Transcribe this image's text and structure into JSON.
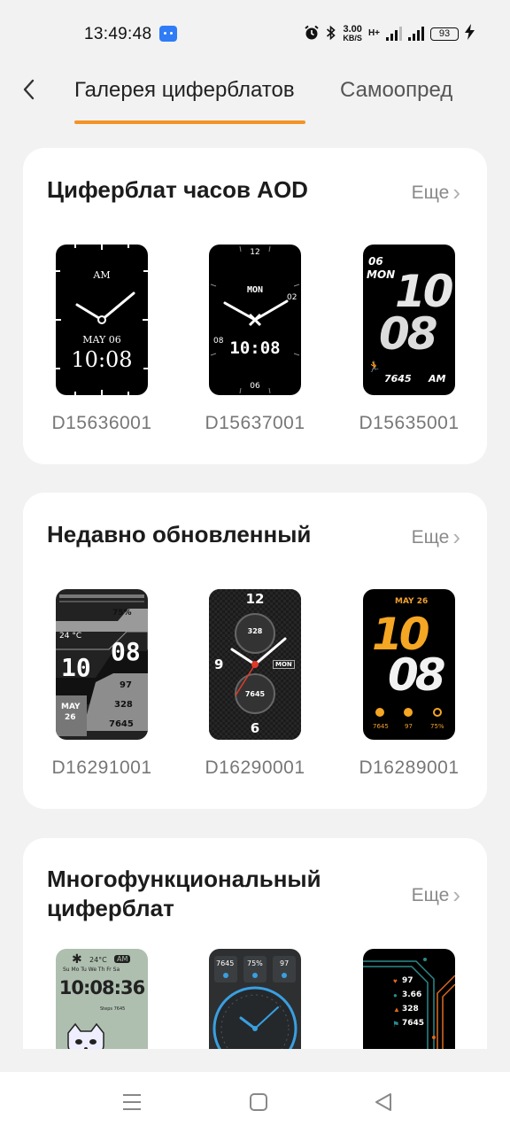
{
  "status_bar": {
    "time": "13:49:48",
    "net_speed_value": "3.00",
    "net_speed_unit": "KB/S",
    "network_type": "H+",
    "battery": "93"
  },
  "header": {
    "tabs": [
      {
        "label": "Галерея циферблатов",
        "active": true
      },
      {
        "label": "Самоопред"
      }
    ]
  },
  "sections": [
    {
      "title": "Циферблат часов AOD",
      "more_label": "Еще",
      "faces": [
        {
          "id": "D15636001",
          "style": "analog-serif",
          "top_text": "AM",
          "date": "MAY 06",
          "time": "10:08"
        },
        {
          "id": "D15637001",
          "style": "analog-digital",
          "num_12": "12",
          "day": "MON",
          "num_02": "02",
          "num_08": "08",
          "time": "10:08",
          "num_06": "06"
        },
        {
          "id": "D15635001",
          "style": "big-digital",
          "date": "06",
          "day": "MON",
          "hour": "10",
          "minute": "08",
          "steps": "7645",
          "ampm": "AM"
        }
      ]
    },
    {
      "title": "Недавно обновленный",
      "more_label": "Еще",
      "faces": [
        {
          "id": "D16291001",
          "style": "grey-tech",
          "battery": "75%",
          "temp": "24 °C",
          "hour": "10",
          "minute": "08",
          "heart": "97",
          "month": "MAY",
          "day": "26",
          "calories": "328",
          "steps": "7645"
        },
        {
          "id": "D16290001",
          "style": "carbon-analog",
          "num_12": "12",
          "num_9": "9",
          "num_6": "6",
          "sub_top": "328",
          "sub_bottom": "7645",
          "day": "MON"
        },
        {
          "id": "D16289001",
          "style": "orange-digital",
          "date": "MAY 26",
          "hour": "10",
          "minute": "08",
          "steps": "7645",
          "heart": "97",
          "battery": "75%"
        }
      ]
    },
    {
      "title": "Многофункциональный циферблат",
      "more_label": "Еще",
      "faces": [
        {
          "id": "",
          "style": "lcd-raccoon",
          "temp": "24°C",
          "ampm": "AM",
          "weekdays": "Su Mo Tu We Th Fr Sa",
          "time": "10:08:36",
          "steps_label": "Steps 7645"
        },
        {
          "id": "",
          "style": "blue-analog",
          "steps": "7645",
          "battery": "75%",
          "heart": "97"
        },
        {
          "id": "",
          "style": "orange-lines",
          "heart": "97",
          "distance": "3.66",
          "calories": "328",
          "steps": "7645"
        }
      ]
    }
  ],
  "colors": {
    "accent": "#f39325",
    "background": "#f2f2f2",
    "card": "#ffffff"
  },
  "icons": [
    "app-notification-icon",
    "alarm-icon",
    "bluetooth-icon",
    "signal-icon",
    "battery-icon",
    "charging-icon",
    "back-arrow-icon",
    "chevron-right-icon",
    "menu-icon",
    "home-icon",
    "back-icon"
  ]
}
